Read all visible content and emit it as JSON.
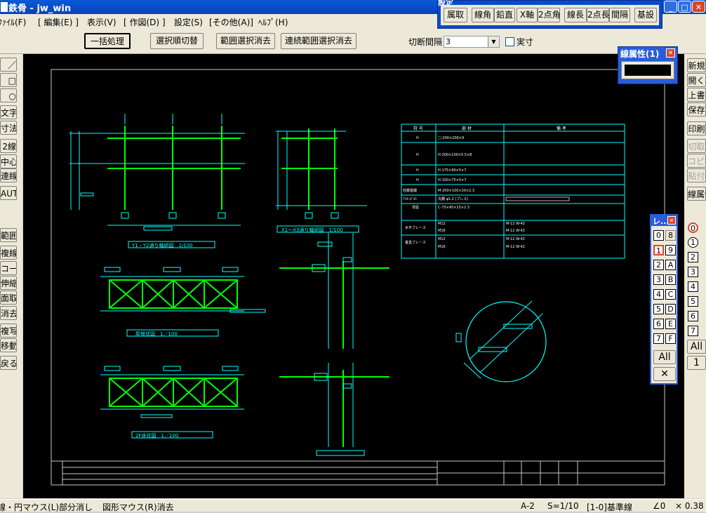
{
  "window": {
    "title": "鉄骨 - jw_win"
  },
  "menu": [
    "ﾌｧｲﾙ(F)",
    "[ 編集(E) ]",
    "表示(V)",
    "[ 作図(D) ]",
    "設定(S)",
    "[その他(A)]",
    "ﾍﾙﾌﾟ(H)"
  ],
  "toolbar": {
    "buttons": [
      "一括処理",
      "選択順切替",
      "範囲選択消去",
      "連続範囲選択消去"
    ],
    "interval_label": "切断間隔",
    "interval_value": "3",
    "actual_label": "実寸"
  },
  "settings_panel": {
    "title": "設定",
    "buttons": [
      "属取",
      "線角",
      "鉛直",
      "X軸",
      "2点角",
      "線長",
      "2点長",
      "間隔",
      "基設"
    ]
  },
  "line_attr": {
    "title": "線属性(1)"
  },
  "layer_window": {
    "title": "レ...",
    "rows": [
      [
        "0",
        "8"
      ],
      [
        "1",
        "9"
      ],
      [
        "2",
        "A"
      ],
      [
        "3",
        "B"
      ],
      [
        "4",
        "C"
      ],
      [
        "5",
        "D"
      ],
      [
        "6",
        "E"
      ],
      [
        "7",
        "F"
      ]
    ],
    "all_label": "All"
  },
  "left_tools": [
    "／",
    "□",
    "○",
    "文字",
    "寸法",
    "2線",
    "中心線",
    "連線",
    "AUTO",
    "範囲",
    "複線",
    "コーナー",
    "伸縮",
    "面取",
    "消去",
    "複写",
    "移動",
    "戻る"
  ],
  "right_tools": [
    "新規",
    "開く",
    "上書",
    "保存",
    "印刷",
    "切取",
    "コピー",
    "貼付",
    "線属性"
  ],
  "right_edge": {
    "layer_labels": [
      "0",
      "1",
      "2",
      "3",
      "4",
      "5",
      "6",
      "7"
    ],
    "all_label": "All",
    "bottom_label": "1"
  },
  "status": {
    "left": "線・円マウス(L)部分消し",
    "right": "図形マウス(R)消去",
    "paper": "A-2",
    "scale": "S=1/10",
    "layer": "[1-0]基準線",
    "angle": "∠0",
    "zoom": "× 0.38"
  },
  "drawing": {
    "labels": {
      "elev1": "Y1・Y2通り軸組図　1/100",
      "elev2": "X1～X3通り軸組図　1/100",
      "plan_roof": "屋根伏図　1／100",
      "plan_2f": "2F床伏図　1／100"
    },
    "table_header": [
      "符 号",
      "部 材",
      "備 考"
    ],
    "table_rows": [
      [
        "H",
        "□-200×200×9",
        ""
      ],
      [
        "H",
        "H-200×100×5.5×8",
        ""
      ],
      [
        "H",
        "H-175×90×5×7",
        ""
      ],
      [
        "H",
        "H-150×75×5×7",
        ""
      ],
      [
        "柱脚基礎",
        "M-200×100×20×2.3",
        ""
      ],
      [
        "ｱﾝｶｰﾎﾞﾙﾄ",
        "丸鋼 φ1.2 (ブレス)",
        ""
      ],
      [
        "母屋",
        "C-75×45×15×2.3",
        ""
      ],
      [
        "水平ブレース",
        "M12",
        "M-12 W-42"
      ],
      [
        "",
        "M16",
        "M-12 W-42"
      ],
      [
        "垂直ブレース",
        "M12",
        "M-12 W-42"
      ],
      [
        "",
        "M16",
        "M-12 W-42"
      ]
    ]
  },
  "colors": {
    "canvas": "#000000",
    "steel": "#00ff00",
    "dim": "#00ffff",
    "title_blue": "#0a5ad8"
  }
}
